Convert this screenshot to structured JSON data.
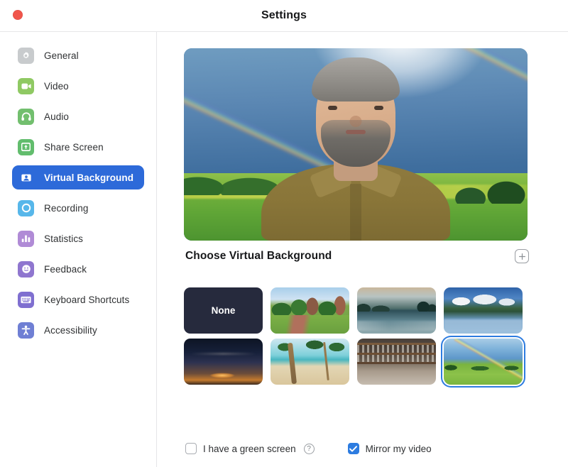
{
  "window": {
    "title": "Settings",
    "close_button": "close"
  },
  "sidebar": {
    "items": [
      {
        "label": "General",
        "icon": "gear-icon",
        "color": "#c8cbcd",
        "active": false
      },
      {
        "label": "Video",
        "icon": "video-camera-icon",
        "color": "#8fc963",
        "active": false
      },
      {
        "label": "Audio",
        "icon": "headphones-icon",
        "color": "#72bf6e",
        "active": false
      },
      {
        "label": "Share Screen",
        "icon": "share-screen-icon",
        "color": "#62bd6d",
        "active": false
      },
      {
        "label": "Virtual Background",
        "icon": "virtual-background-icon",
        "color": "#ffffff",
        "active": true
      },
      {
        "label": "Recording",
        "icon": "recording-icon",
        "color": "#57b7ea",
        "active": false
      },
      {
        "label": "Statistics",
        "icon": "statistics-icon",
        "color": "#b08bd6",
        "active": false
      },
      {
        "label": "Feedback",
        "icon": "feedback-icon",
        "color": "#8f76cf",
        "active": false
      },
      {
        "label": "Keyboard Shortcuts",
        "icon": "keyboard-icon",
        "color": "#7f6fd0",
        "active": false
      },
      {
        "label": "Accessibility",
        "icon": "accessibility-icon",
        "color": "#6f7fd4",
        "active": false
      }
    ],
    "active_accent": "#2d6ad9"
  },
  "main": {
    "preview": {
      "alt": "video-preview-with-rainbow-virtual-background"
    },
    "section": {
      "title": "Choose Virtual Background",
      "add_button": "+"
    },
    "backgrounds": [
      {
        "name": "None",
        "type": "none",
        "selected": false
      },
      {
        "name": "Campus walkway",
        "type": "campus",
        "selected": false
      },
      {
        "name": "Lake at sunrise",
        "type": "lake",
        "selected": false
      },
      {
        "name": "Clouds over lake",
        "type": "clouds",
        "selected": false
      },
      {
        "name": "Dusk sky",
        "type": "dusk",
        "selected": false
      },
      {
        "name": "Tropical beach",
        "type": "beach",
        "selected": false
      },
      {
        "name": "Bar shelves",
        "type": "bar",
        "selected": false
      },
      {
        "name": "Rainbow over field",
        "type": "rainbow",
        "selected": true
      }
    ],
    "footer": {
      "green_screen_label": "I have a green screen",
      "green_screen_checked": false,
      "help_glyph": "?",
      "mirror_label": "Mirror my video",
      "mirror_checked": true,
      "checked_color": "#2d7ce0"
    }
  }
}
